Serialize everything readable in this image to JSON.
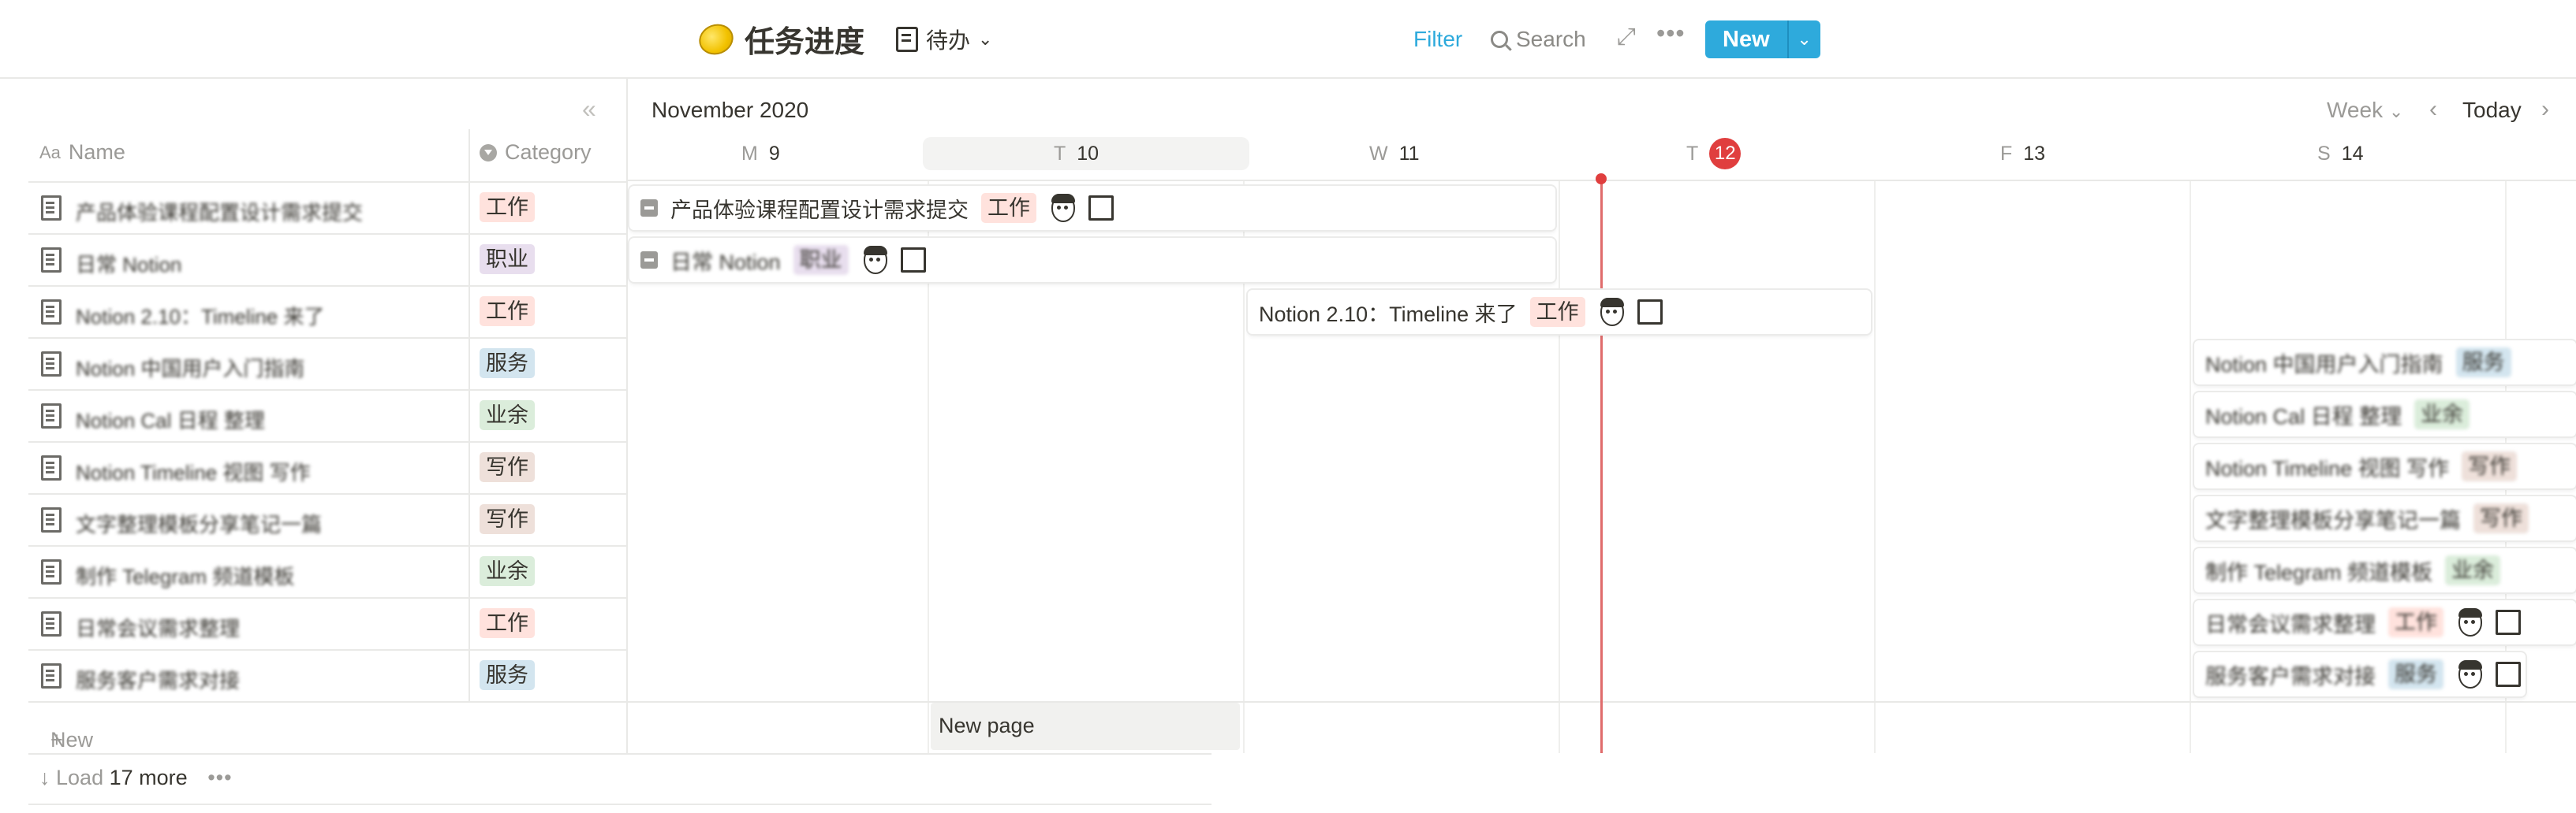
{
  "header": {
    "title": "任务进度",
    "view_label": "待办",
    "filter_label": "Filter",
    "search_label": "Search",
    "new_label": "New"
  },
  "table": {
    "col_name": "Name",
    "col_category": "Category",
    "name_icon_label": "Aa",
    "rows": [
      {
        "name": "产品体验课程配置设计需求提交",
        "category": "工作",
        "color": "#ffe2dd"
      },
      {
        "name": "日常 Notion",
        "category": "职业",
        "color": "#e8deee"
      },
      {
        "name": "Notion 2.10：Timeline 来了",
        "category": "工作",
        "color": "#ffe2dd"
      },
      {
        "name": "Notion 中国用户入门指南",
        "category": "服务",
        "color": "#d3e5ef"
      },
      {
        "name": "Notion Cal 日程 整理",
        "category": "业余",
        "color": "#dbeddb"
      },
      {
        "name": "Notion Timeline 视图 写作",
        "category": "写作",
        "color": "#eee0da"
      },
      {
        "name": "文字整理模板分享笔记一篇",
        "category": "写作",
        "color": "#eee0da"
      },
      {
        "name": "制作 Telegram 频道模板",
        "category": "业余",
        "color": "#dbeddb"
      },
      {
        "name": "日常会议需求整理",
        "category": "工作",
        "color": "#ffe2dd"
      },
      {
        "name": "服务客户需求对接",
        "category": "服务",
        "color": "#d3e5ef"
      }
    ],
    "new_label": "New",
    "load_prefix": "Load",
    "load_count": "17 more"
  },
  "timeline": {
    "month": "November 2020",
    "zoom": "Week",
    "today_label": "Today",
    "days": [
      {
        "dow": "M",
        "num": "9"
      },
      {
        "dow": "T",
        "num": "10"
      },
      {
        "dow": "W",
        "num": "11"
      },
      {
        "dow": "T",
        "num": "12"
      },
      {
        "dow": "F",
        "num": "13"
      },
      {
        "dow": "S",
        "num": "14"
      }
    ],
    "bars": [
      {
        "title": "产品体验课程配置设计需求提交",
        "tag": "工作",
        "tag_color": "#ffe2dd"
      },
      {
        "title": "日常 Notion",
        "tag": "职业",
        "tag_color": "#e8deee"
      },
      {
        "title": "Notion 2.10：Timeline 来了",
        "tag": "工作",
        "tag_color": "#ffe2dd"
      }
    ],
    "right_items": [
      {
        "title": "Notion 中国用户入门指南",
        "tag": "服务",
        "tag_color": "#d3e5ef"
      },
      {
        "title": "Notion Cal 日程 整理",
        "tag": "业余",
        "tag_color": "#dbeddb"
      },
      {
        "title": "Notion Timeline 视图 写作",
        "tag": "写作",
        "tag_color": "#eee0da"
      },
      {
        "title": "文字整理模板分享笔记一篇",
        "tag": "写作",
        "tag_color": "#eee0da"
      },
      {
        "title": "制作 Telegram 频道模板",
        "tag": "业余",
        "tag_color": "#dbeddb"
      },
      {
        "title": "日常会议需求整理",
        "tag": "工作",
        "tag_color": "#ffe2dd"
      },
      {
        "title": "服务客户需求对接",
        "tag": "服务",
        "tag_color": "#d3e5ef"
      }
    ],
    "new_page_label": "New page"
  },
  "colors": {
    "accent": "#2eaadc",
    "today": "#e03e3e"
  }
}
